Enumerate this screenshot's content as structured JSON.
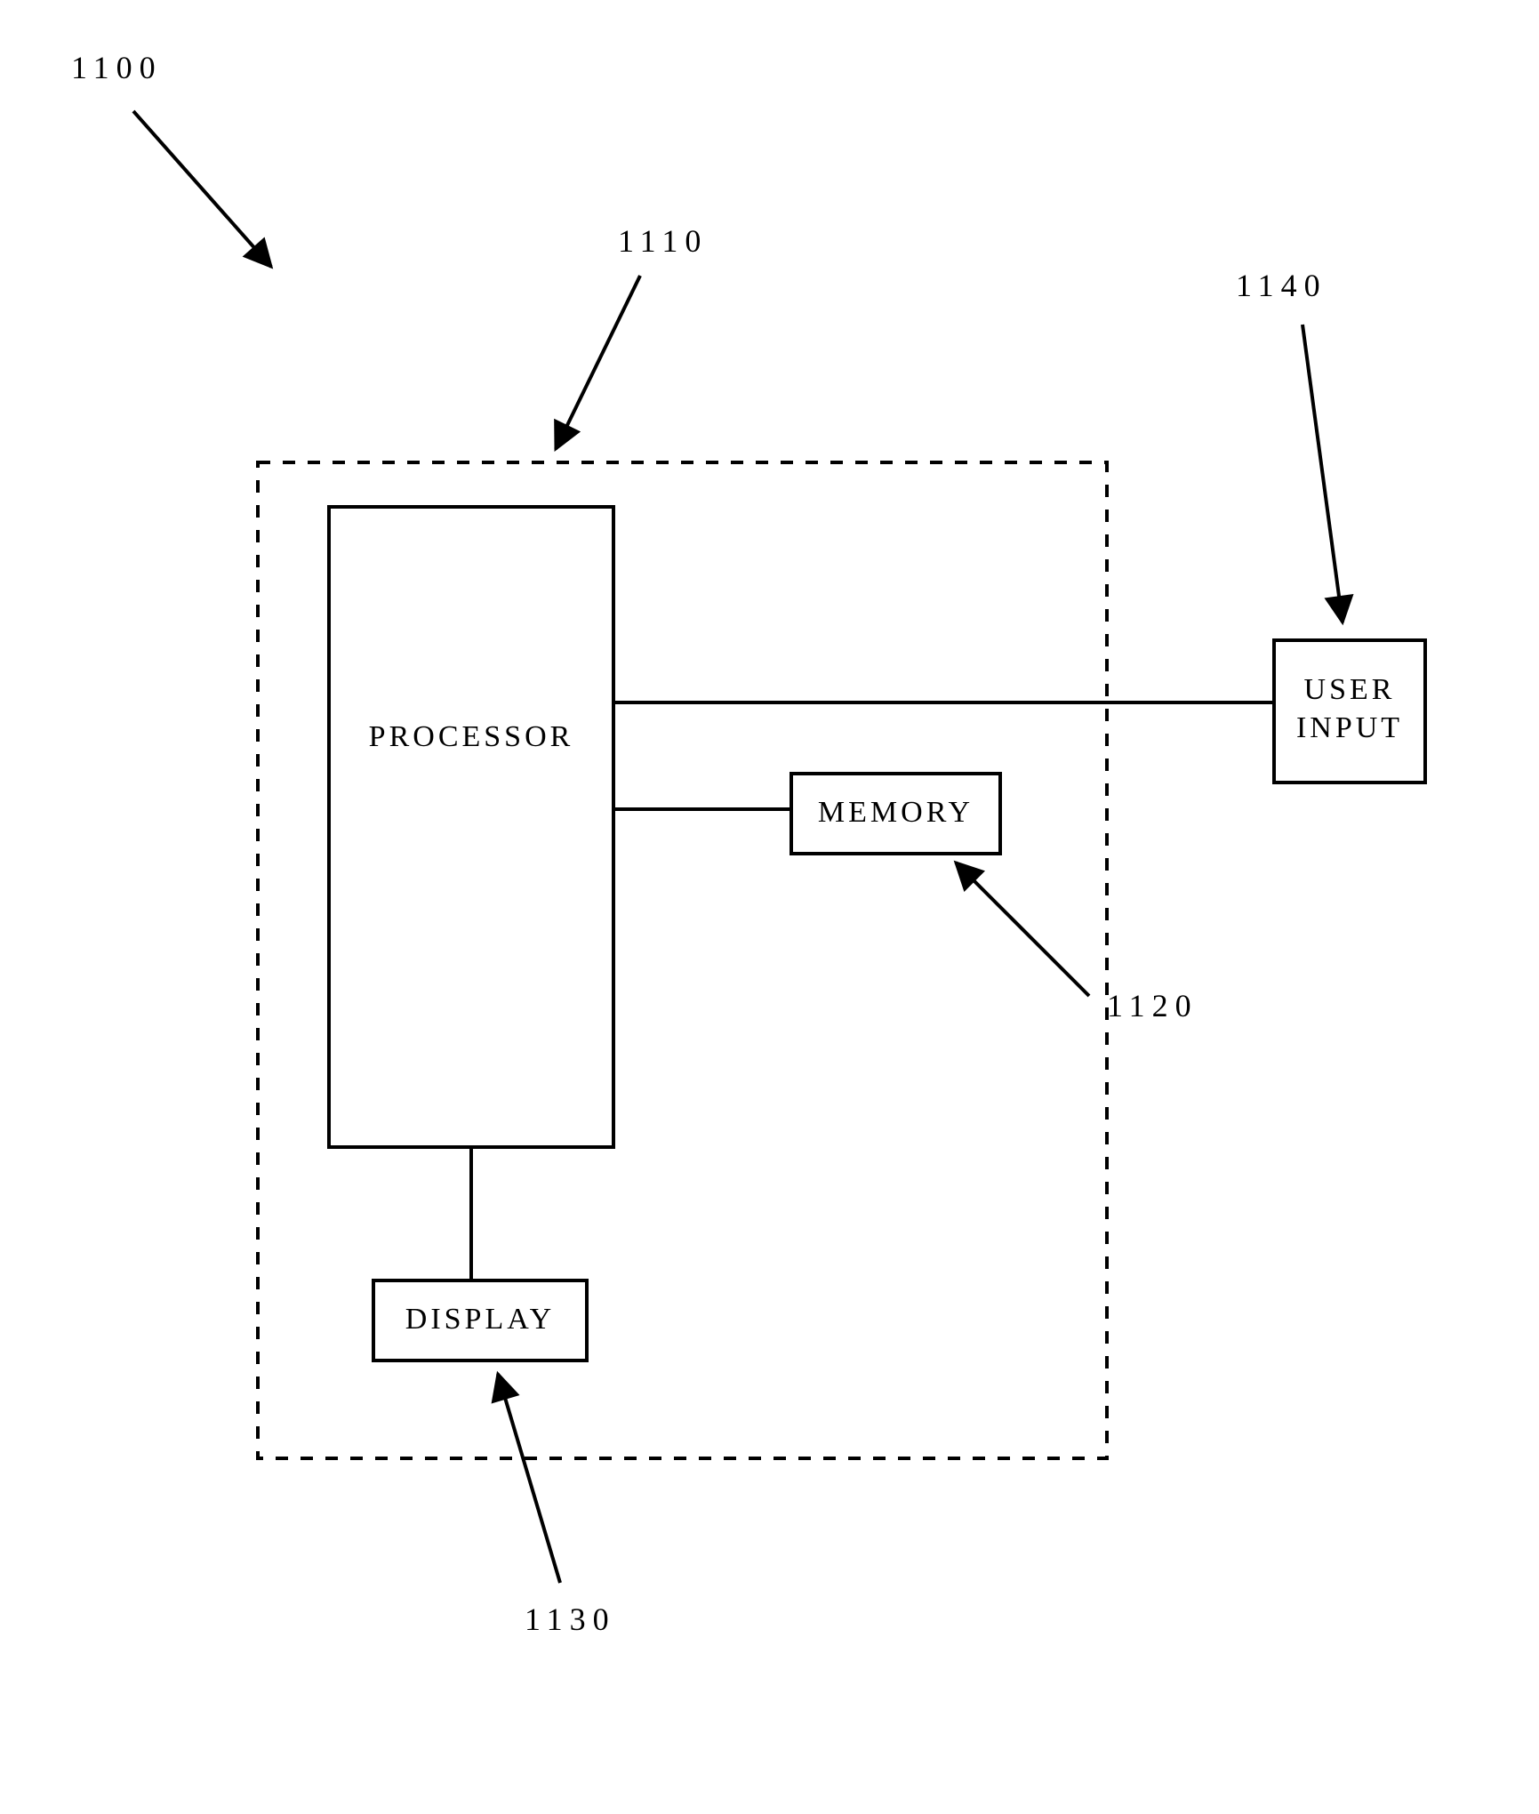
{
  "refs": {
    "system": "1100",
    "device": "1110",
    "memory": "1120",
    "display": "1130",
    "userinput": "1140"
  },
  "blocks": {
    "processor": "PROCESSOR",
    "memory": "MEMORY",
    "display": "DISPLAY",
    "userinput": "USER\nINPUT"
  }
}
